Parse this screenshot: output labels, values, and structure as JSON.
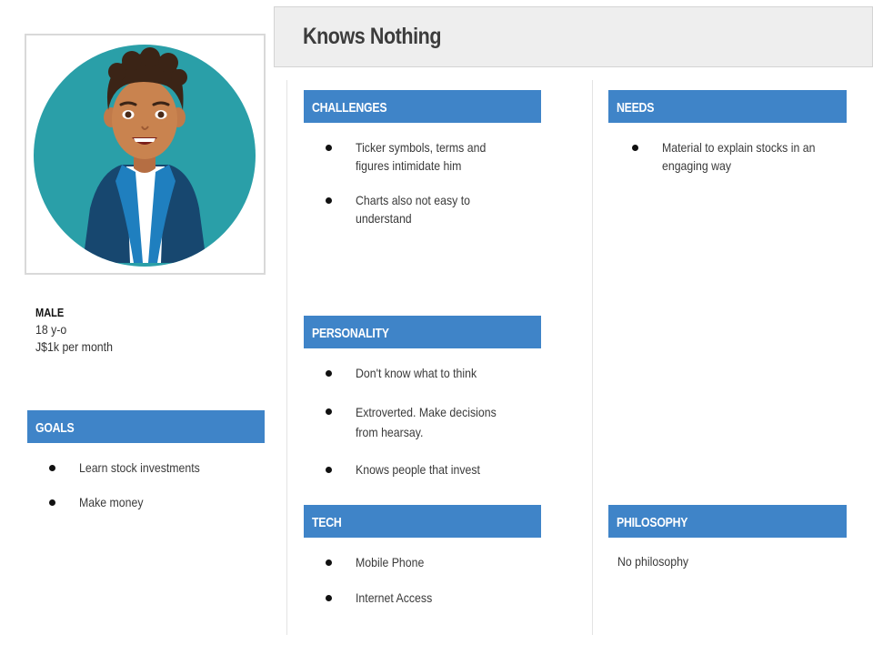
{
  "persona": {
    "name": "Knows Nothing",
    "gender": "MALE",
    "age": "18 y-o",
    "income": "J$1k per month"
  },
  "sections": {
    "goals": {
      "title": "GOALS",
      "items": [
        "Learn stock investments",
        "Make money"
      ]
    },
    "challenges": {
      "title": "CHALLENGES",
      "items": [
        "Ticker symbols, terms and figures intimidate him",
        "Charts also not easy to understand"
      ]
    },
    "needs": {
      "title": "NEEDS",
      "items": [
        "Material to explain stocks in an engaging way"
      ]
    },
    "personality": {
      "title": "PERSONALITY",
      "items": [
        "Don't know what to think",
        "Extroverted. Make decisions from hearsay.",
        "Knows people that invest"
      ]
    },
    "tech": {
      "title": "TECH",
      "items": [
        "Mobile Phone",
        "Internet Access"
      ]
    },
    "philosophy": {
      "title": "PHILOSOPHY",
      "text": "No philosophy"
    }
  },
  "colors": {
    "header_blue": "#3f84c8",
    "title_bg": "#eeeeee",
    "avatar_circle": "#2a9fa8"
  },
  "icons": {
    "avatar": "male-avatar-illustration",
    "bullet": "bullet-dot-icon"
  }
}
